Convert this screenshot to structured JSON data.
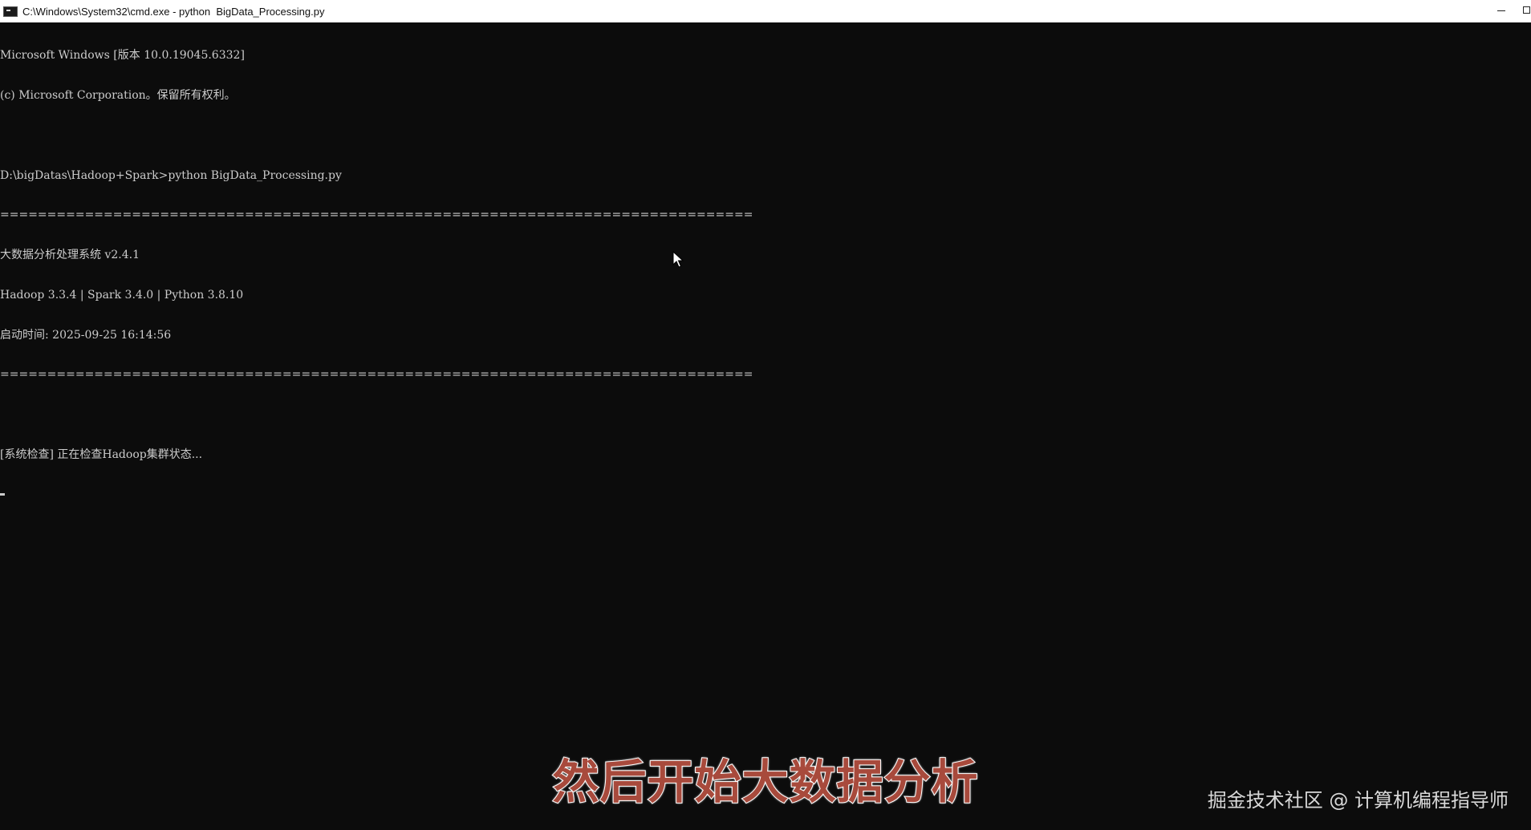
{
  "window": {
    "title": "C:\\Windows\\System32\\cmd.exe - python  BigData_Processing.py",
    "app_icon": "cmd-icon",
    "controls": [
      "minimize-icon",
      "maximize-icon"
    ]
  },
  "console": {
    "lines": [
      "Microsoft Windows [版本 10.0.19045.6332]",
      "(c) Microsoft Corporation。保留所有权利。",
      "",
      "D:\\bigDatas\\Hadoop+Spark>python BigData_Processing.py",
      "================================================================================",
      "大数据分析处理系统 v2.4.1",
      "Hadoop 3.3.4 | Spark 3.4.0 | Python 3.8.10",
      "启动时间: 2025-09-25 16:14:56",
      "================================================================================",
      "",
      "[系统检查] 正在检查Hadoop集群状态..."
    ]
  },
  "overlay": {
    "subtitle": "然后开始大数据分析",
    "watermark": "掘金技术社区 @ 计算机编程指导师",
    "subtitle_color": "#a84a3c"
  },
  "colors": {
    "console_bg": "#0c0c0c",
    "console_fg": "#cccccc",
    "titlebar_bg": "#ffffff"
  }
}
